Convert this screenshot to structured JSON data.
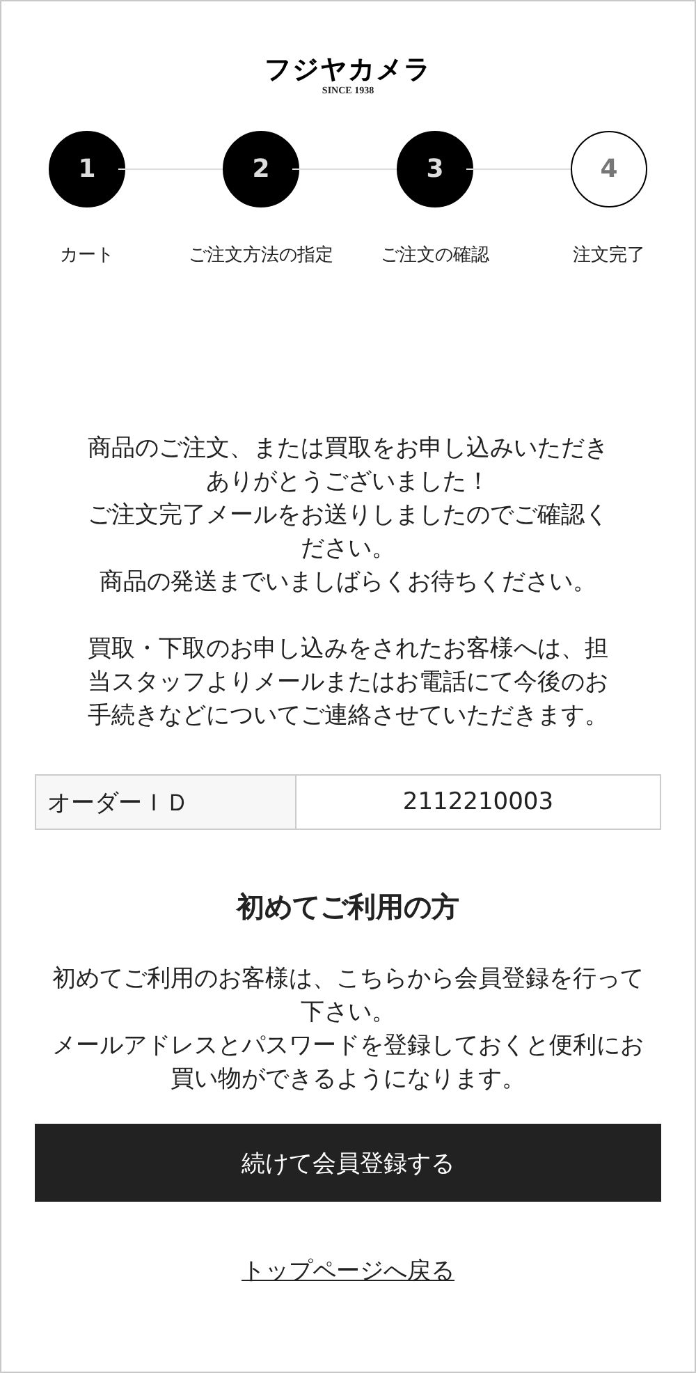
{
  "logo": {
    "name": "フジヤカメラ",
    "tagline": "SINCE 1938"
  },
  "steps": [
    {
      "number": "1",
      "label": "カート",
      "completed": true
    },
    {
      "number": "2",
      "label": "ご注文方法の指定",
      "completed": true
    },
    {
      "number": "3",
      "label": "ご注文の確認",
      "completed": true
    },
    {
      "number": "4",
      "label": "注文完了",
      "completed": false
    }
  ],
  "message": [
    "商品のご注文、または買取をお申し込みいただきありがとうございました！",
    "ご注文完了メールをお送りしましたのでご確認ください。",
    "商品の発送までいましばらくお待ちください。"
  ],
  "notice": "買取・下取のお申し込みをされたお客様へは、担当スタッフよりメールまたはお電話にて今後のお手続きなどについてご連絡させていただきます。",
  "order": {
    "label": "オーダーＩＤ",
    "value": "2112210003"
  },
  "first_time": {
    "heading": "初めてご利用の方",
    "lines": [
      "初めてご利用のお客様は、こちらから会員登録を行って下さい。",
      "メールアドレスとパスワードを登録しておくと便利にお買い物ができるようになります。"
    ],
    "button": "続けて会員登録する"
  },
  "back_link": "トップページへ戻る"
}
